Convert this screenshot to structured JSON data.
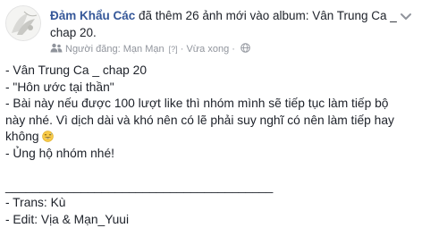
{
  "post": {
    "author": "Đảm Khẩu Các",
    "action_text": " đã thêm 26 ảnh mới vào album: Vân Trung Ca _ chap 20.",
    "posted_by_label": "Người đăng: ",
    "posted_by_name": "Mạn Mạn",
    "tag_hint": "[?]",
    "separator": " · ",
    "time": "Vừa xong",
    "separator2": " · ",
    "body_lines": [
      "- Vân Trung Ca _ chap 20",
      "- \"Hôn ước tại thần\"",
      "- Bài này nếu được 100 lượt like thì nhóm mình sẽ tiếp tục làm tiếp bộ",
      "này nhé. Vì dịch dài và khó nên có lẽ phải suy nghĩ có nên làm tiếp hay",
      "không",
      "- Ủng hộ nhóm nhé!",
      "_______________________________________",
      "- Trans: Kù",
      "- Edit: Vịa & Mạn_Yuui"
    ],
    "icons": {
      "avatar": "avatar-illustration",
      "people": "people-icon",
      "globe": "globe-icon",
      "emoji": "grinning-sweat-emoji-icon",
      "more": "chevron-down-icon"
    },
    "colors": {
      "author": "#365899",
      "meta": "#90949c",
      "text": "#1d2129"
    }
  }
}
